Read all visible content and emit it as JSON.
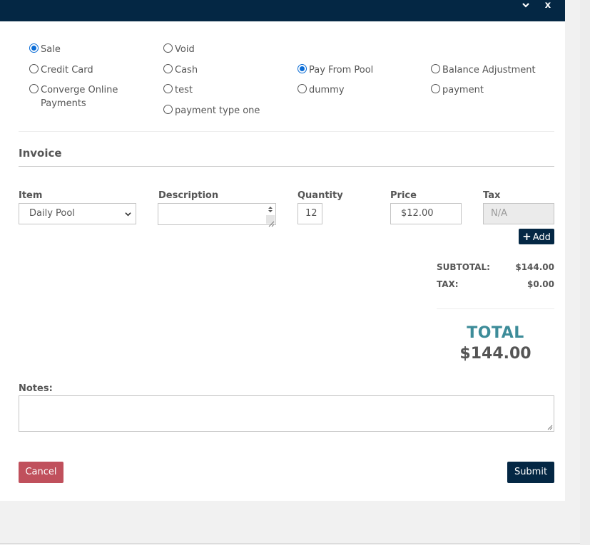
{
  "titlebar": {
    "minimize_icon": "chevron-down-icon",
    "close_icon": "close-icon",
    "close_glyph": "x"
  },
  "payment_types": [
    {
      "label": "Sale",
      "checked": true
    },
    {
      "label": "Void",
      "checked": false
    },
    {
      "label": "Credit Card",
      "checked": false
    },
    {
      "label": "Cash",
      "checked": false
    },
    {
      "label": "Pay From Pool",
      "checked": true
    },
    {
      "label": "Balance Adjustment",
      "checked": false
    },
    {
      "label": "Converge Online Payments",
      "checked": false
    },
    {
      "label": "test",
      "checked": false
    },
    {
      "label": "dummy",
      "checked": false
    },
    {
      "label": "payment",
      "checked": false
    },
    {
      "label": "payment type one",
      "checked": false
    }
  ],
  "invoice": {
    "title": "Invoice",
    "columns": {
      "item": "Item",
      "description": "Description",
      "quantity": "Quantity",
      "price": "Price",
      "tax": "Tax"
    },
    "item_value": "Daily Pool",
    "description_value": "",
    "quantity_value": "12",
    "price_value": "$12.00",
    "tax_value": "N/A",
    "add_label": "Add",
    "add_icon": "plus-icon"
  },
  "summary": {
    "subtotal_label": "SUBTOTAL:",
    "subtotal_value": "$144.00",
    "tax_label": "TAX:",
    "tax_value": "$0.00",
    "total_label": "TOTAL",
    "total_value": "$144.00"
  },
  "notes": {
    "label": "Notes:",
    "value": ""
  },
  "actions": {
    "cancel_label": "Cancel",
    "submit_label": "Submit"
  },
  "colors": {
    "navy": "#042744",
    "total_teal": "#3d8c99",
    "cancel_red": "#c0505c",
    "radio_blue": "#0a6cd6"
  }
}
